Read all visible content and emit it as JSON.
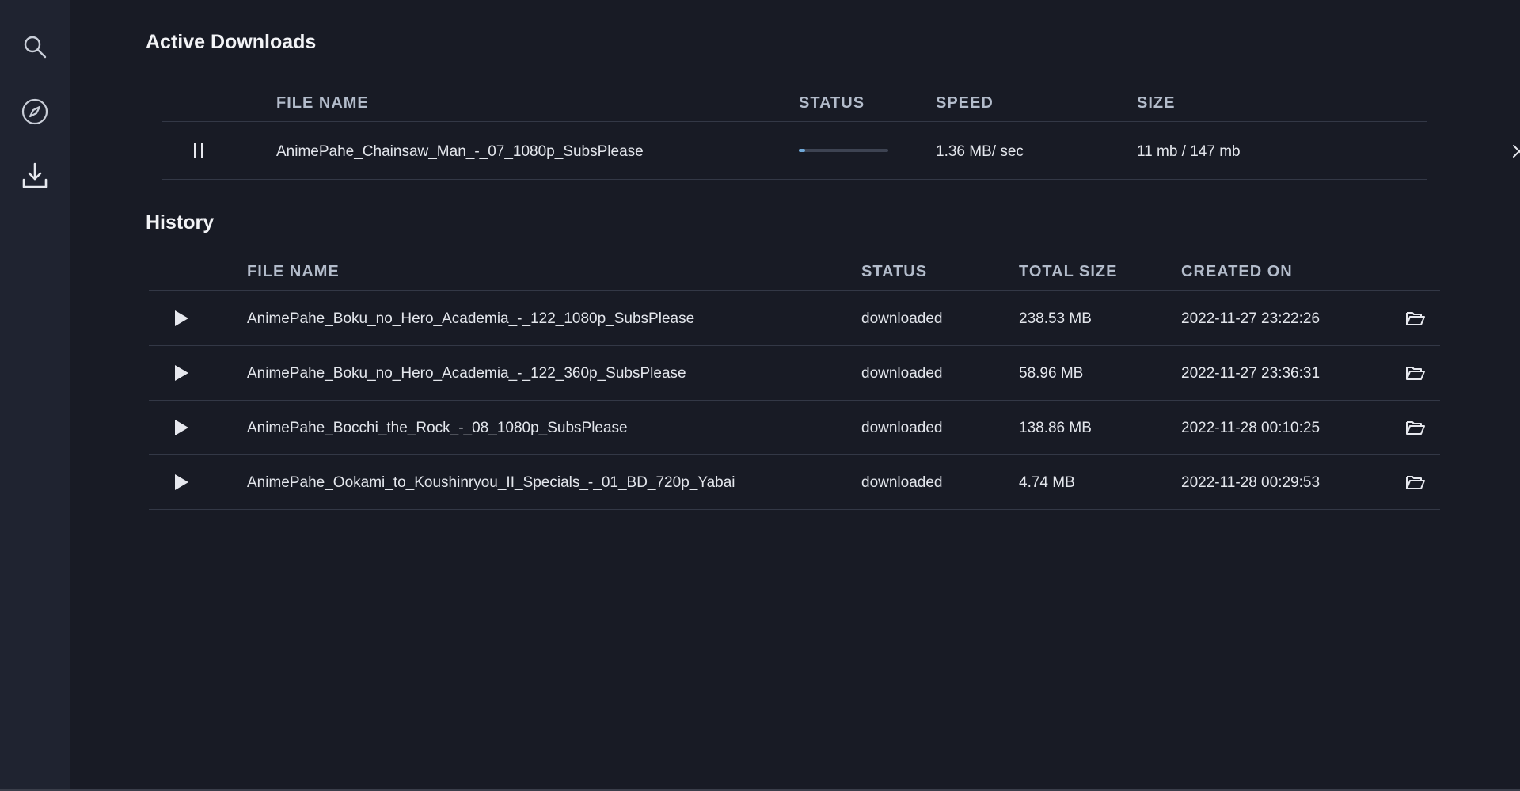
{
  "sidebar": {
    "items": [
      {
        "icon": "search-icon"
      },
      {
        "icon": "compass-icon"
      },
      {
        "icon": "download-icon"
      }
    ]
  },
  "active": {
    "title": "Active Downloads",
    "headers": {
      "file_name": "FILE NAME",
      "status": "STATUS",
      "speed": "SPEED",
      "size": "SIZE"
    },
    "rows": [
      {
        "file_name": "AnimePahe_Chainsaw_Man_-_07_1080p_SubsPlease",
        "progress": 0.075,
        "speed": "1.36 MB/ sec",
        "size": "11 mb / 147 mb"
      }
    ]
  },
  "history": {
    "title": "History",
    "headers": {
      "file_name": "FILE NAME",
      "status": "STATUS",
      "total_size": "TOTAL SIZE",
      "created_on": "CREATED ON"
    },
    "rows": [
      {
        "file_name": "AnimePahe_Boku_no_Hero_Academia_-_122_1080p_SubsPlease",
        "status": "downloaded",
        "total_size": "238.53 MB",
        "created_on": "2022-11-27 23:22:26"
      },
      {
        "file_name": "AnimePahe_Boku_no_Hero_Academia_-_122_360p_SubsPlease",
        "status": "downloaded",
        "total_size": "58.96 MB",
        "created_on": "2022-11-27 23:36:31"
      },
      {
        "file_name": "AnimePahe_Bocchi_the_Rock_-_08_1080p_SubsPlease",
        "status": "downloaded",
        "total_size": "138.86 MB",
        "created_on": "2022-11-28 00:10:25"
      },
      {
        "file_name": "AnimePahe_Ookami_to_Koushinryou_II_Specials_-_01_BD_720p_Yabai",
        "status": "downloaded",
        "total_size": "4.74 MB",
        "created_on": "2022-11-28 00:29:53"
      }
    ]
  },
  "colors": {
    "background": "#181b25",
    "sidebar": "#1f2330",
    "progress_fill": "#6fa8d8",
    "header_text": "#b3bccb"
  }
}
